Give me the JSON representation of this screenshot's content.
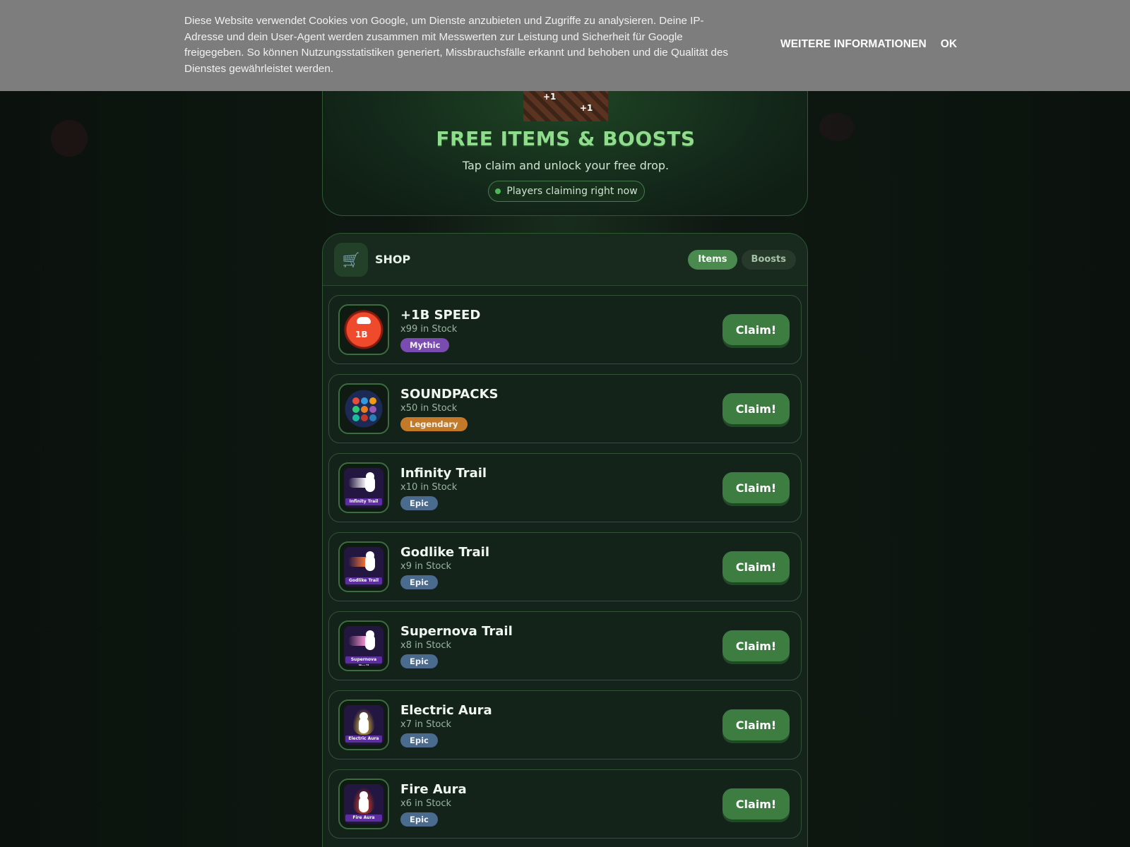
{
  "cookie_banner": {
    "text": "Diese Website verwendet Cookies von Google, um Dienste anzubieten und Zugriffe zu analysieren. Deine IP-Adresse und dein User-Agent werden zusammen mit Messwerten zur Leistung und Sicherheit für Google freigegeben. So können Nutzungsstatistiken generiert, Missbrauchsfälle erkannt und behoben und die Qualität des Dienstes gewährleistet werden.",
    "more_info_label": "WEITERE INFORMATIONEN",
    "ok_label": "OK"
  },
  "hero": {
    "title": "FREE ITEMS & BOOSTS",
    "subtitle": "Tap claim and unlock your free drop.",
    "pill": "Players claiming right now",
    "image_overlay": [
      "+1",
      "+1"
    ]
  },
  "shop": {
    "title": "SHOP",
    "cart_icon": "🛒",
    "tabs": [
      {
        "label": "Items",
        "active": true
      },
      {
        "label": "Boosts",
        "active": false
      }
    ],
    "claim_label": "Claim!",
    "items": [
      {
        "name": "+1B SPEED",
        "stock": "x99 in Stock",
        "rarity": "Mythic",
        "rarity_color": "#7a4bb0",
        "icon": "speed-icon",
        "thumb_text": "1B"
      },
      {
        "name": "SOUNDPACKS",
        "stock": "x50 in Stock",
        "rarity": "Legendary",
        "rarity_color": "#c27a28",
        "icon": "soundpacks-icon"
      },
      {
        "name": "Infinity Trail",
        "stock": "x10 in Stock",
        "rarity": "Epic",
        "rarity_color": "#4a6a8e",
        "icon": "infinity-trail-icon",
        "thumb_label": "Infinity Trail",
        "streak_color": "#ffffff"
      },
      {
        "name": "Godlike Trail",
        "stock": "x9 in Stock",
        "rarity": "Epic",
        "rarity_color": "#4a6a8e",
        "icon": "godlike-trail-icon",
        "thumb_label": "Godlike Trail",
        "streak_color": "#ff7a3a"
      },
      {
        "name": "Supernova Trail",
        "stock": "x8 in Stock",
        "rarity": "Epic",
        "rarity_color": "#4a6a8e",
        "icon": "supernova-trail-icon",
        "thumb_label": "Supernova Trail",
        "streak_color": "#ff9ad6"
      },
      {
        "name": "Electric Aura",
        "stock": "x7 in Stock",
        "rarity": "Epic",
        "rarity_color": "#4a6a8e",
        "icon": "electric-aura-icon",
        "thumb_label": "Electric Aura",
        "aura_color": "#ffd93a"
      },
      {
        "name": "Fire Aura",
        "stock": "x6 in Stock",
        "rarity": "Epic",
        "rarity_color": "#4a6a8e",
        "icon": "fire-aura-icon",
        "thumb_label": "Fire Aura",
        "aura_color": "#ff4a1a"
      }
    ]
  }
}
